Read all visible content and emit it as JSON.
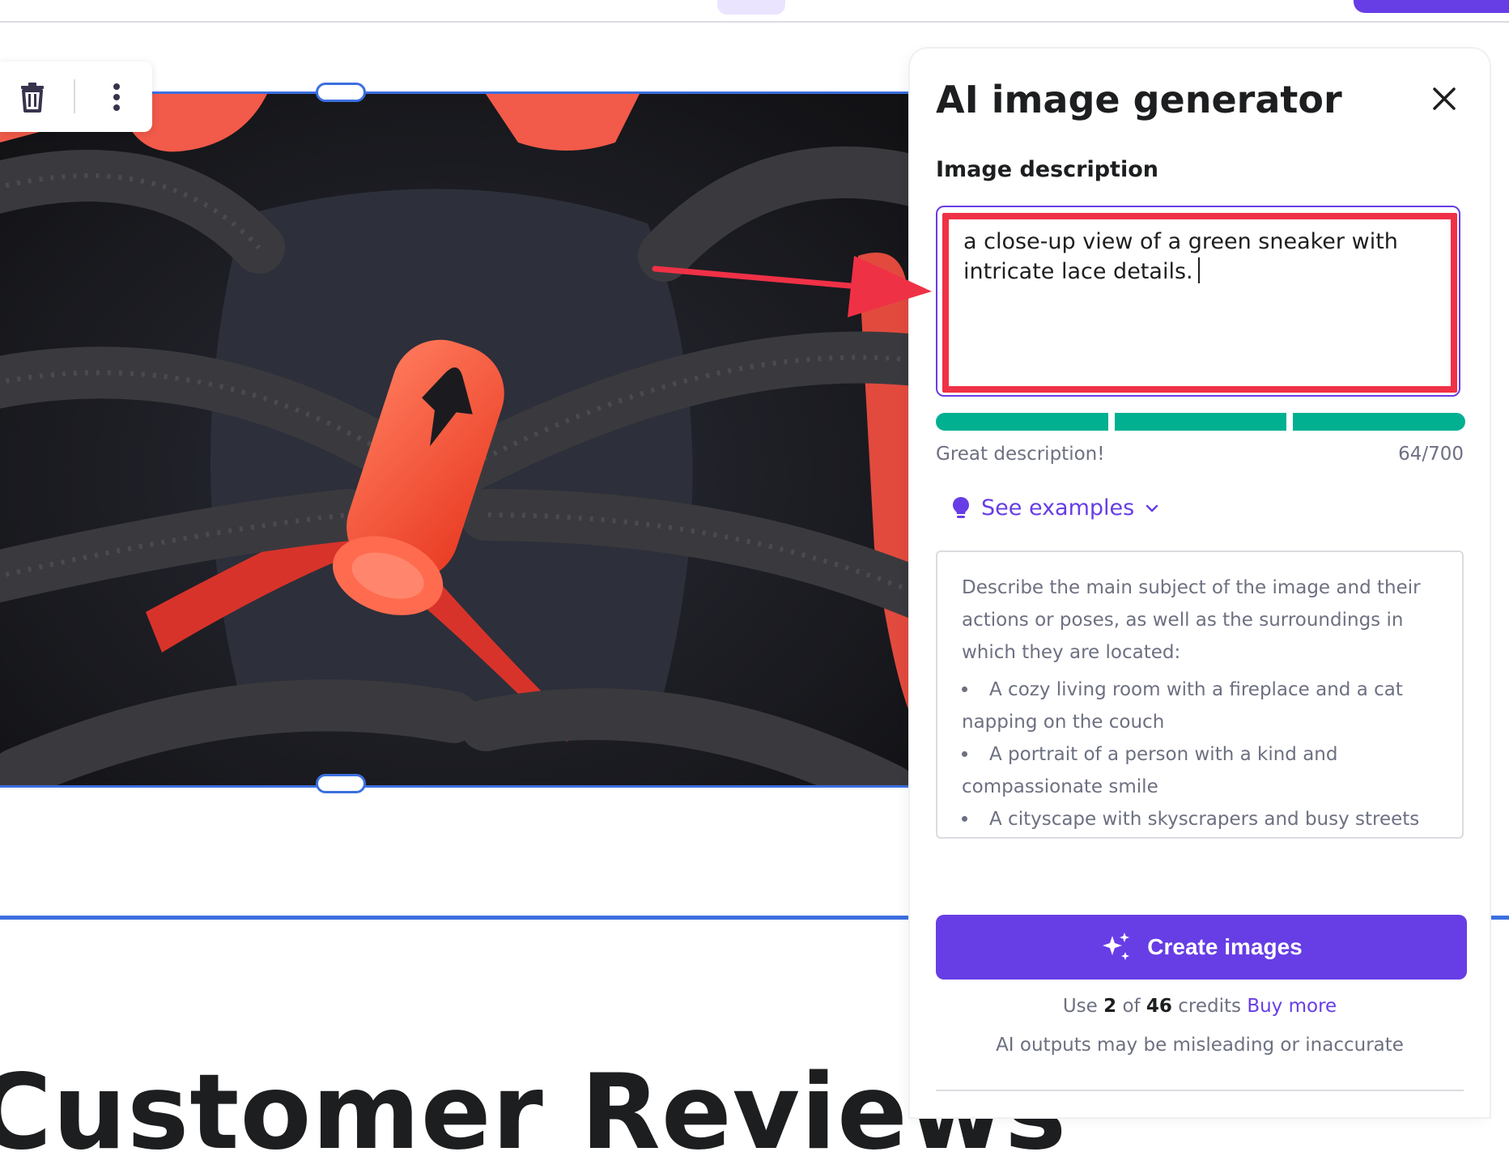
{
  "toolbar": {
    "delete_icon": "trash-icon",
    "more_icon": "more-vertical-icon"
  },
  "page": {
    "section_heading": "Customer Reviews"
  },
  "panel": {
    "title": "AI image generator",
    "close_icon": "close-icon",
    "description_label": "Image description",
    "description_value": "a close-up view of a green sneaker with intricate lace details.",
    "quality": {
      "segments_filled": 3,
      "segments_total": 3,
      "label": "Great description!",
      "count": "64/700",
      "color": "#00b090"
    },
    "examples_label": "See examples",
    "hints": {
      "intro": "Describe the main subject of the image and their actions or poses, as well as the surroundings in which they are located:",
      "items": [
        "A cozy living room with a fireplace and a cat napping on the couch",
        "A portrait of a person with a kind and compassionate smile",
        "A cityscape with skyscrapers and busy streets"
      ]
    },
    "create_button": "Create images",
    "credits": {
      "prefix": "Use",
      "use": "2",
      "of_word": "of",
      "total": "46",
      "suffix": "credits",
      "buy_more": "Buy more"
    },
    "disclaimer": "AI outputs may be misleading or inaccurate"
  },
  "colors": {
    "accent": "#673de6",
    "selection": "#3b6fe0",
    "annotation": "#ef3146",
    "success": "#00b090"
  }
}
